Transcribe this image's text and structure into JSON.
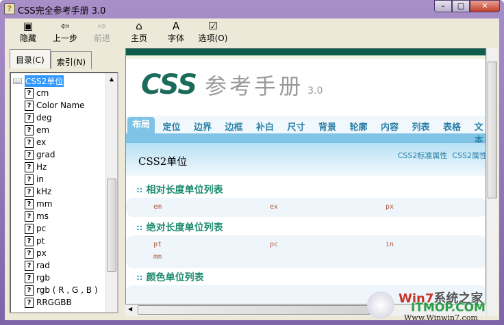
{
  "window": {
    "title": "CSS完全参考手册 3.0",
    "controls": [
      "minimize",
      "maximize",
      "close"
    ]
  },
  "toolbar": [
    {
      "label": "隐藏",
      "icon": "hide-pane-icon"
    },
    {
      "label": "上一步",
      "icon": "back-arrow-icon"
    },
    {
      "label": "前进",
      "icon": "forward-arrow-icon",
      "disabled": true
    },
    {
      "label": "主页",
      "icon": "home-icon"
    },
    {
      "label": "字体",
      "icon": "font-icon"
    },
    {
      "label": "选项(O)",
      "icon": "options-icon"
    }
  ],
  "left_tabs": [
    {
      "label": "目录(C)",
      "active": true
    },
    {
      "label": "索引(N)"
    }
  ],
  "tree": {
    "root": "CSS2单位",
    "items": [
      "cm",
      "Color Name",
      "deg",
      "em",
      "ex",
      "grad",
      "Hz",
      "in",
      "kHz",
      "mm",
      "ms",
      "pc",
      "pt",
      "px",
      "rad",
      "rgb",
      "rgb ( R , G , B )",
      "RRGGBB"
    ]
  },
  "page": {
    "logo": {
      "css": "CSS",
      "title": "参考手册",
      "version": "3.0"
    },
    "nav": [
      "布局",
      "定位",
      "边界",
      "边框",
      "补白",
      "尺寸",
      "背景",
      "轮廓",
      "内容",
      "列表",
      "表格",
      "文本"
    ],
    "heading": "CSS2单位",
    "links": [
      "CSS2标准属性",
      "CSS2属性"
    ],
    "sections": [
      {
        "title": "相对长度单位列表",
        "units": [
          "em",
          "ex",
          "px"
        ]
      },
      {
        "title": "绝对长度单位列表",
        "units": [
          "pt",
          "pc",
          "in",
          "mm"
        ]
      },
      {
        "title": "颜色单位列表",
        "units": []
      }
    ]
  },
  "watermark": {
    "text": "Win7系统之家",
    "site": "ITMOP.COM",
    "url": "Www.Winwin7.com"
  }
}
